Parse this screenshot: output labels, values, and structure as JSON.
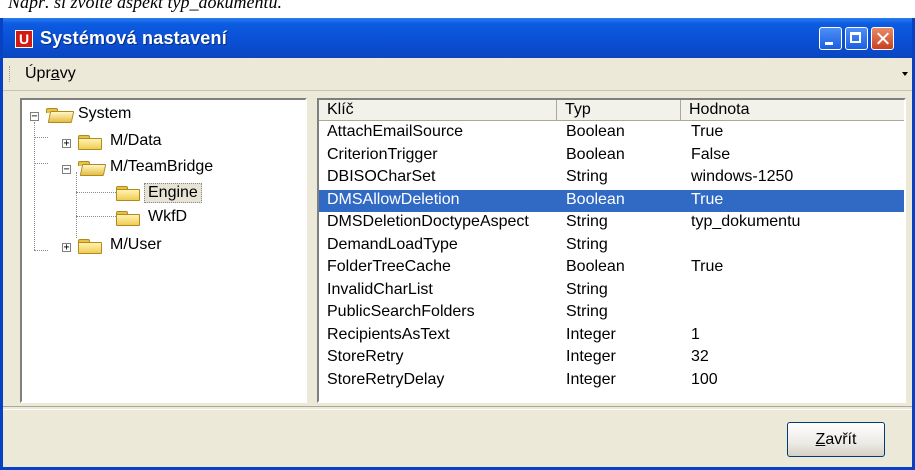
{
  "caption": "Např. si zvolte aspekt typ_dokumentu.",
  "window": {
    "title": "Systémová nastavení",
    "icon_letter": "U",
    "controls": [
      "minimize-icon",
      "maximize-icon",
      "close-icon"
    ]
  },
  "menu": {
    "upravy_pre": "Úpr",
    "upravy_underline": "a",
    "upravy_post": "vy"
  },
  "tree": {
    "system": "System",
    "m_data": "M/Data",
    "m_teambridge": "M/TeamBridge",
    "engine": "Engine",
    "wkfd": "WkfD",
    "m_user": "M/User",
    "expanders": {
      "system": "−",
      "m_data": "+",
      "m_teambridge": "−",
      "m_user": "+"
    }
  },
  "table": {
    "columns": [
      "Klíč",
      "Typ",
      "Hodnota"
    ],
    "rows": [
      [
        "AttachEmailSource",
        "Boolean",
        "True"
      ],
      [
        "CriterionTrigger",
        "Boolean",
        "False"
      ],
      [
        "DBISOCharSet",
        "String",
        "windows-1250"
      ],
      [
        "DMSAllowDeletion",
        "Boolean",
        "True"
      ],
      [
        "DMSDeletionDoctypeAspect",
        "String",
        "typ_dokumentu"
      ],
      [
        "DemandLoadType",
        "String",
        ""
      ],
      [
        "FolderTreeCache",
        "Boolean",
        "True"
      ],
      [
        "InvalidCharList",
        "String",
        ""
      ],
      [
        "PublicSearchFolders",
        "String",
        ""
      ],
      [
        "RecipientsAsText",
        "Integer",
        "1"
      ],
      [
        "StoreRetry",
        "Integer",
        "32"
      ],
      [
        "StoreRetryDelay",
        "Integer",
        "100"
      ]
    ],
    "selected_key": "DMSAllowDeletion"
  },
  "footer": {
    "close_pre": "",
    "close_underline": "Z",
    "close_post": "avřít"
  },
  "colors": {
    "titlebar": "#0a4fd4",
    "selection": "#316ac5",
    "face": "#ece9d8"
  }
}
